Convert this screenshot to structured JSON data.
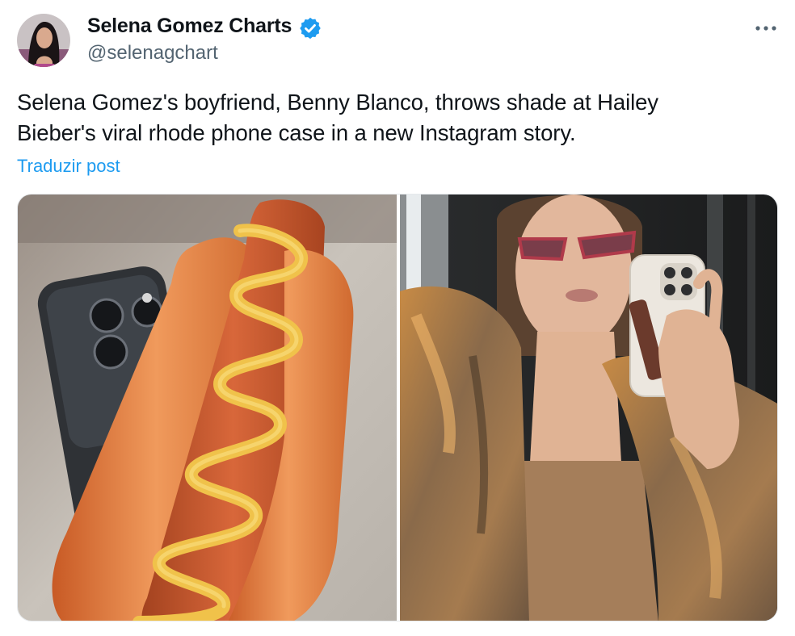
{
  "tweet": {
    "author": {
      "name": "Selena Gomez Charts",
      "handle": "@selenagchart",
      "verified": true,
      "avatar_icon": "profile-photo",
      "verified_icon": "verified-badge-icon",
      "verified_color": "#1d9bf0"
    },
    "more_icon": "more-options-icon",
    "text_lines": [
      "Selena Gomez's boyfriend, Benny Blanco, throws shade at Hailey",
      "Bieber's viral rhode phone case in a new Instagram story."
    ],
    "translate_label": "Traduzir post",
    "link_color": "#1d9bf0",
    "media": [
      {
        "kind": "photo",
        "subject": "hot dog with mustard beside a phone"
      },
      {
        "kind": "photo",
        "subject": "woman in fur coat taking mirror selfie"
      }
    ]
  }
}
